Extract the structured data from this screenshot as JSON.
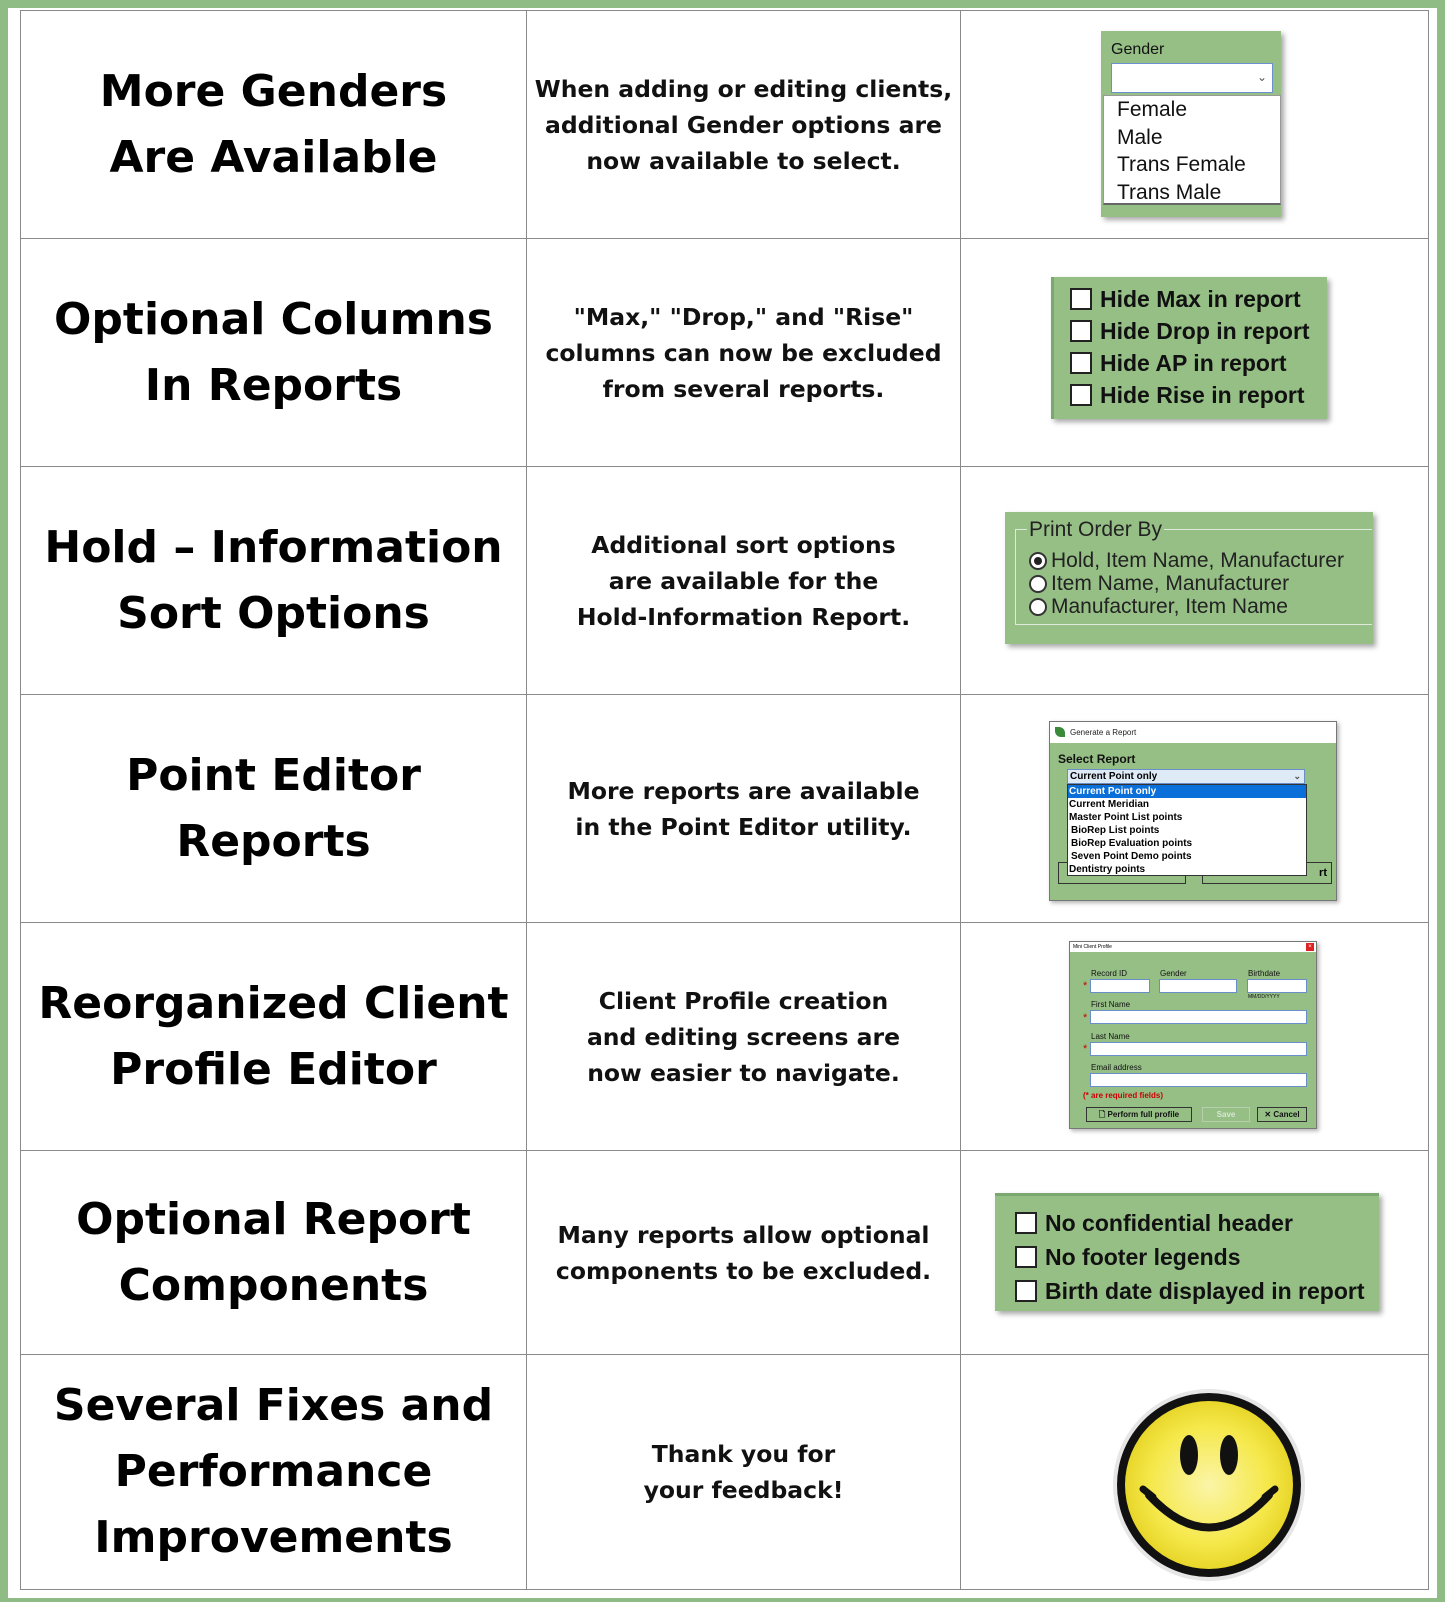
{
  "rows": [
    {
      "title": [
        "More Genders",
        "Are Available"
      ],
      "description": [
        "When adding or editing clients,",
        "additional Gender options are",
        "now available to select."
      ],
      "gender_shot": {
        "label": "Gender",
        "options": [
          "Female",
          "Male",
          "Trans Female",
          "Trans Male"
        ]
      }
    },
    {
      "title": [
        "Optional Columns",
        "In Reports"
      ],
      "description": [
        "\"Max,\" \"Drop,\" and \"Rise\"",
        "columns can now be excluded",
        "from several reports."
      ],
      "checkboxes": [
        "Hide Max in report",
        "Hide Drop in report",
        "Hide AP in report",
        "Hide Rise in report"
      ]
    },
    {
      "title": [
        "Hold – Information",
        "Sort Options"
      ],
      "description": [
        "Additional sort options",
        "are available for the",
        "Hold-Information Report."
      ],
      "radio_group": {
        "legend": "Print Order By",
        "options": [
          "Hold, Item Name, Manufacturer",
          "Item Name, Manufacturer",
          "Manufacturer, Item Name"
        ],
        "selected": 0
      }
    },
    {
      "title": [
        "Point Editor",
        "Reports"
      ],
      "description": [
        "More reports are available",
        "in the Point Editor utility."
      ],
      "report_window": {
        "window_title": "Generate a Report",
        "select_label": "Select Report",
        "selected_value": "Current Point only",
        "options": [
          "Current Point only",
          "Current Meridian",
          "Master Point List points",
          "BioRep List points",
          "BioRep Evaluation points",
          "Seven Point Demo points",
          "Dentistry points"
        ],
        "partial_button_text": "rt"
      }
    },
    {
      "title": [
        "Reorganized Client",
        "Profile Editor"
      ],
      "description": [
        "Client Profile creation",
        "and editing screens are",
        "now easier to navigate."
      ],
      "mini_profile": {
        "window_title": "Mini Client Profile",
        "record_id_label": "Record ID",
        "gender_label": "Gender",
        "birthdate_label": "Birthdate",
        "date_hint": "MM/DD/YYYY",
        "first_name_label": "First Name",
        "last_name_label": "Last Name",
        "email_label": "Email address",
        "required_note": "(* are required fields)",
        "full_profile_button": "Perform full profile",
        "save_button": "Save",
        "cancel_button": "Cancel"
      }
    },
    {
      "title": [
        "Optional Report",
        "Components"
      ],
      "description": [
        "Many reports allow optional",
        "components to be excluded."
      ],
      "checkboxes": [
        "No confidential header",
        "No footer legends",
        "Birth date displayed in report"
      ]
    },
    {
      "title": [
        "Several Fixes and",
        "Performance",
        "Improvements"
      ],
      "description": [
        "Thank you for",
        "your feedback!"
      ],
      "image": "smiley-face-icon"
    }
  ],
  "colors": {
    "frame_green": "#8fbc84",
    "panel_green": "#96bf86",
    "selection_blue": "#0a6fd8",
    "smiley_yellow": "#f5e84a"
  }
}
